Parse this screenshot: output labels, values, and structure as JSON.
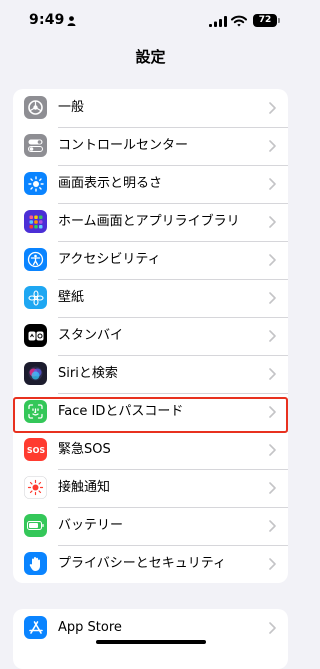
{
  "status_bar": {
    "time": "9:49",
    "battery_level": "72"
  },
  "nav": {
    "title": "設定"
  },
  "settings": {
    "items": [
      {
        "label": "一般",
        "icon": "gear-icon",
        "color": "#8e8e93"
      },
      {
        "label": "コントロールセンター",
        "icon": "toggles-icon",
        "color": "#8e8e93"
      },
      {
        "label": "画面表示と明るさ",
        "icon": "brightness-icon",
        "color": "#0a84ff"
      },
      {
        "label": "ホーム画面とアプリライブラリ",
        "icon": "app-grid-icon",
        "color": "#4b2fd6"
      },
      {
        "label": "アクセシビリティ",
        "icon": "accessibility-icon",
        "color": "#0a84ff"
      },
      {
        "label": "壁紙",
        "icon": "wallpaper-flower-icon",
        "color": "#1ea7f2"
      },
      {
        "label": "スタンバイ",
        "icon": "standby-icon",
        "color": "#000000"
      },
      {
        "label": "Siriと検索",
        "icon": "siri-icon",
        "color": "#1c1c2e"
      },
      {
        "label": "Face IDとパスコード",
        "icon": "face-id-icon",
        "color": "#34c759"
      },
      {
        "label": "緊急SOS",
        "icon": "sos-icon",
        "color": "#ff3b30"
      },
      {
        "label": "接触通知",
        "icon": "exposure-notification-icon",
        "color": "#ffffff"
      },
      {
        "label": "バッテリー",
        "icon": "battery-icon",
        "color": "#34c759"
      },
      {
        "label": "プライバシーとセキュリティ",
        "icon": "hand-icon",
        "color": "#0a84ff"
      }
    ],
    "store_items": [
      {
        "label": "App Store",
        "icon": "app-store-icon",
        "color": "#0a84ff"
      }
    ]
  },
  "highlight_color": "#e8311f"
}
